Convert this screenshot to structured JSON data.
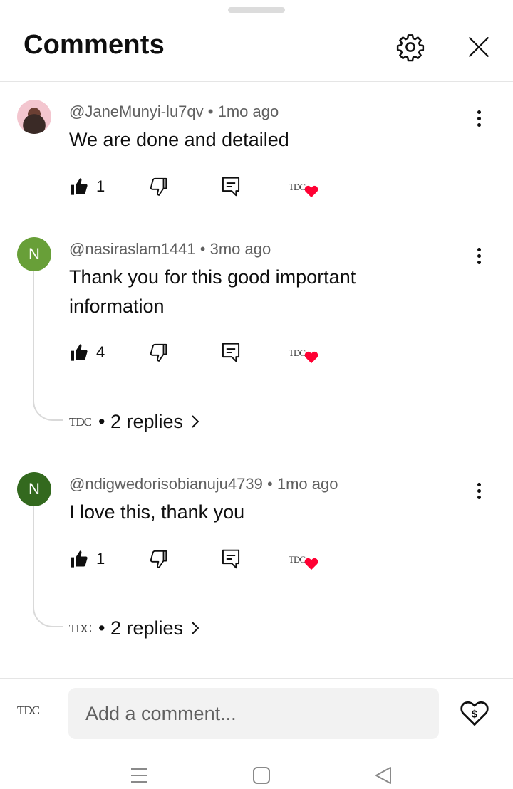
{
  "header": {
    "title": "Comments",
    "settings_icon": "gear-icon",
    "close_icon": "close-icon"
  },
  "comments": [
    {
      "author": "@JaneMunyi-lu7qv",
      "time": "1mo ago",
      "text": "We are done and detailed",
      "likes": "1",
      "avatar_type": "photo"
    },
    {
      "author": "@nasiraslam1441",
      "time": "3mo ago",
      "text": "Thank you for this good important information",
      "likes": "4",
      "avatar_letter": "N",
      "avatar_color": "#689f38",
      "replies_label": "2 replies"
    },
    {
      "author": "@ndigwedorisobianuju4739",
      "time": "1mo ago",
      "text": "I love this, thank you",
      "likes": "1",
      "avatar_letter": "N",
      "avatar_color": "#33691e",
      "replies_label": "2 replies"
    }
  ],
  "creator_logo": "TDC",
  "composer": {
    "placeholder": "Add a comment...",
    "thanks_icon": "super-thanks-heart-dollar-icon"
  },
  "colors": {
    "heart": "#ff0033",
    "text_primary": "#0f0f0f",
    "text_secondary": "#606060",
    "input_bg": "#f2f2f2"
  }
}
